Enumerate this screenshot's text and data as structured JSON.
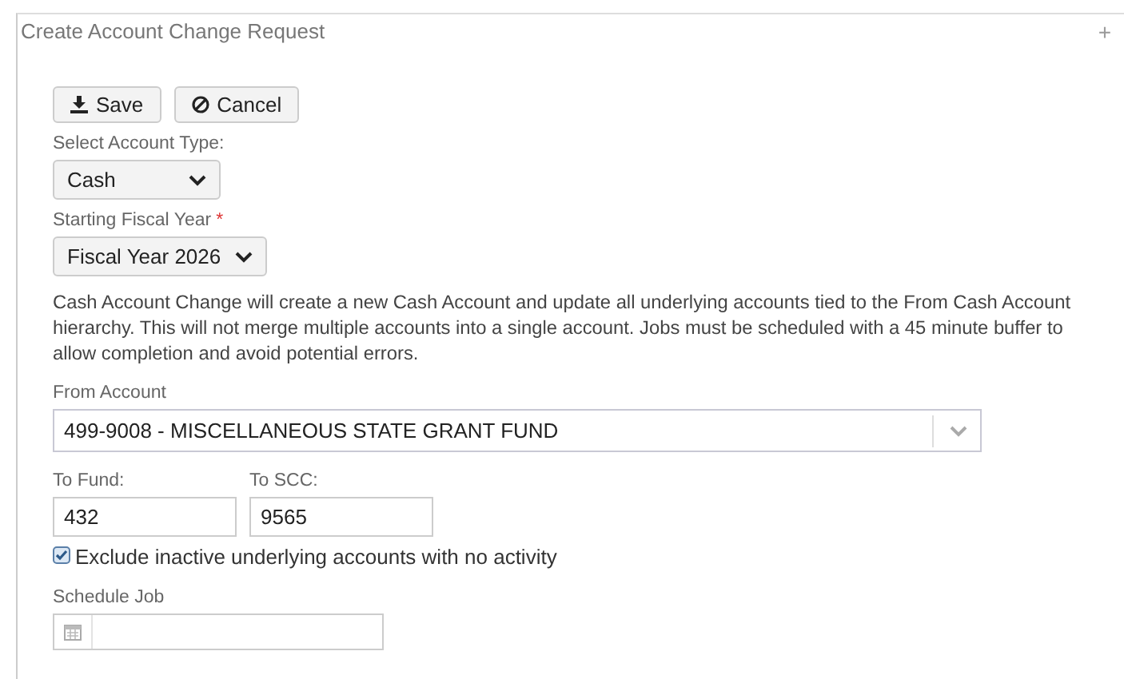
{
  "panel": {
    "title": "Create Account Change Request",
    "header_icon": "+"
  },
  "buttons": [
    {
      "kind": "save",
      "label": "Save"
    },
    {
      "kind": "cancel",
      "label": "Cancel"
    }
  ],
  "account_type": {
    "label": "Select Account Type:",
    "value": "Cash"
  },
  "fiscal_year": {
    "label": "Starting Fiscal Year",
    "required_mark": "*",
    "value": "Fiscal Year 2026"
  },
  "notice": "Cash Account Change will create a new Cash Account and update all underlying accounts tied to the From Cash Account hierarchy. This will not merge multiple accounts into a single account. Jobs must be scheduled with a 45 minute buffer to allow completion and avoid potential errors.",
  "from_account": {
    "label": "From Account",
    "value": "499-9008 - MISCELLANEOUS STATE GRANT FUND"
  },
  "to_fund": {
    "label": "To Fund:",
    "value": "432"
  },
  "to_scc": {
    "label": "To SCC:",
    "value": "9565"
  },
  "exclude_inactive": {
    "label": "Exclude inactive underlying accounts with no activity",
    "checked": true
  },
  "schedule_job": {
    "label": "Schedule Job"
  }
}
